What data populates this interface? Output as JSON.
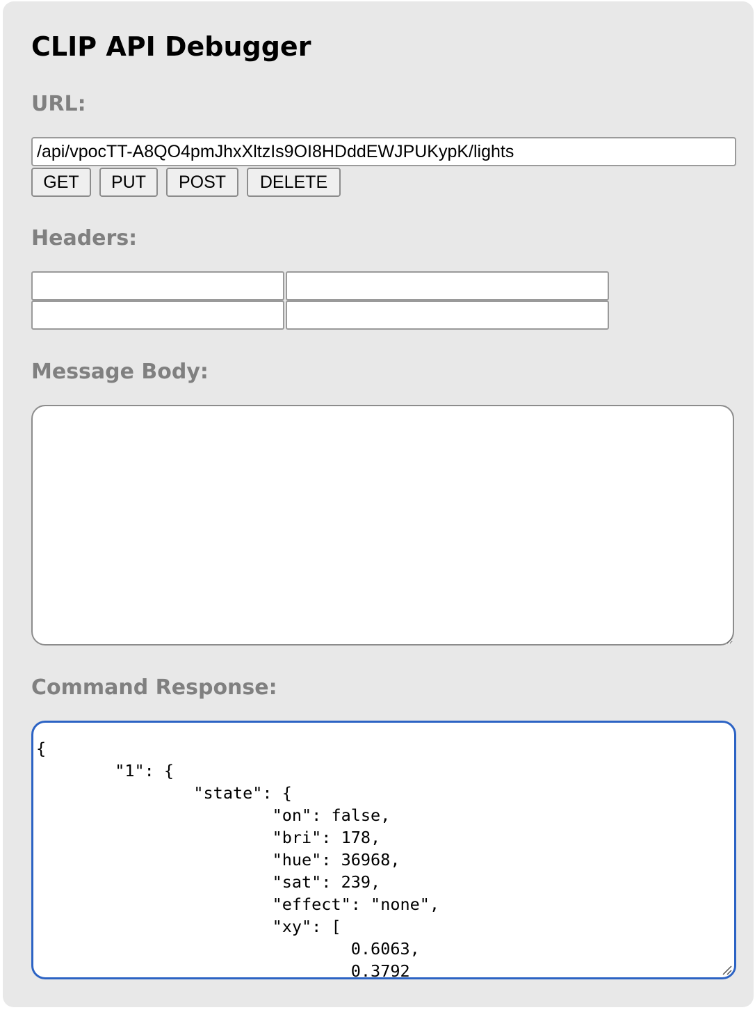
{
  "app": {
    "title": "CLIP API Debugger"
  },
  "url_section": {
    "label": "URL:",
    "value": "/api/vpocTT-A8QO4pmJhxXltzIs9OI8HDddEWJPUKypK/lights"
  },
  "buttons": {
    "get": "GET",
    "put": "PUT",
    "post": "POST",
    "delete": "DELETE"
  },
  "headers_section": {
    "label": "Headers:",
    "rows": [
      {
        "name": "",
        "value": ""
      },
      {
        "name": "",
        "value": ""
      }
    ]
  },
  "body_section": {
    "label": "Message Body:",
    "value": ""
  },
  "response_section": {
    "label": "Command Response:",
    "value": "{\n\t\"1\": {\n\t\t\"state\": {\n\t\t\t\"on\": false,\n\t\t\t\"bri\": 178,\n\t\t\t\"hue\": 36968,\n\t\t\t\"sat\": 239,\n\t\t\t\"effect\": \"none\",\n\t\t\t\"xy\": [\n\t\t\t\t0.6063,\n\t\t\t\t0.3792"
  },
  "colors": {
    "panel_background": "#e8e8e8",
    "section_label": "#808080",
    "focus_border": "#2c63c4"
  }
}
